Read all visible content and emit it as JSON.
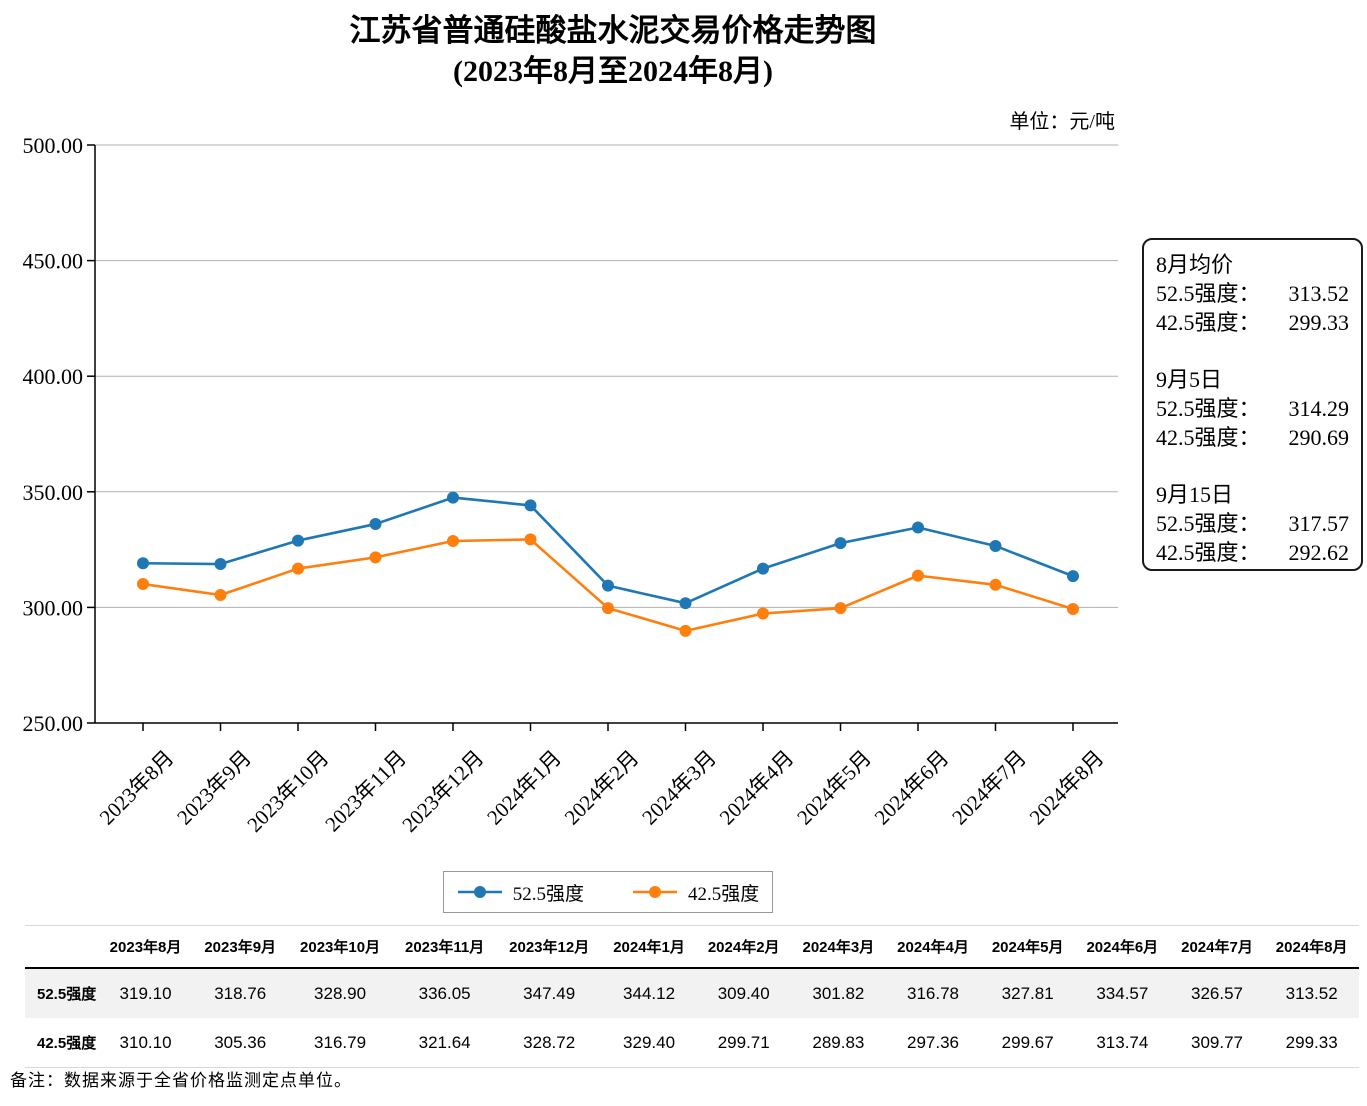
{
  "title": {
    "line1": "江苏省普通硅酸盐水泥交易价格走势图",
    "line2": "(2023年8月至2024年8月)"
  },
  "unit_label": "单位：元/吨",
  "colors": {
    "series_525": "#1f77b4",
    "series_425": "#ff7f0e",
    "gridline": "#b0b0b0",
    "axis": "#000000",
    "table_stripe": "#f2f2f2"
  },
  "chart_data": {
    "type": "line",
    "title": "江苏省普通硅酸盐水泥交易价格走势图 (2023年8月至2024年8月)",
    "xlabel": "",
    "ylabel": "元/吨",
    "ylim": [
      250,
      500
    ],
    "ytick_step": 50,
    "ytick_labels": [
      "250.00",
      "300.00",
      "350.00",
      "400.00",
      "450.00",
      "500.00"
    ],
    "grid": true,
    "legend_position": "bottom",
    "categories": [
      "2023年8月",
      "2023年9月",
      "2023年10月",
      "2023年11月",
      "2023年12月",
      "2024年1月",
      "2024年2月",
      "2024年3月",
      "2024年4月",
      "2024年5月",
      "2024年6月",
      "2024年7月",
      "2024年8月"
    ],
    "series": [
      {
        "name": "52.5强度",
        "color": "#1f77b4",
        "marker": "circle",
        "values": [
          319.1,
          318.76,
          328.9,
          336.05,
          347.49,
          344.12,
          309.4,
          301.82,
          316.78,
          327.81,
          334.57,
          326.57,
          313.52
        ]
      },
      {
        "name": "42.5强度",
        "color": "#ff7f0e",
        "marker": "circle",
        "values": [
          310.1,
          305.36,
          316.79,
          321.64,
          328.72,
          329.4,
          299.71,
          289.83,
          297.36,
          299.67,
          313.74,
          309.77,
          299.33
        ]
      }
    ]
  },
  "legend": {
    "items": [
      {
        "label": "52.5强度",
        "color": "#1f77b4"
      },
      {
        "label": "42.5强度",
        "color": "#ff7f0e"
      }
    ]
  },
  "annotation": {
    "groups": [
      {
        "header": "8月均价",
        "rows": [
          {
            "label": "52.5强度：",
            "value": "313.52"
          },
          {
            "label": "42.5强度：",
            "value": "299.33"
          }
        ]
      },
      {
        "header": "9月5日",
        "rows": [
          {
            "label": "52.5强度：",
            "value": "314.29"
          },
          {
            "label": "42.5强度：",
            "value": "290.69"
          }
        ]
      },
      {
        "header": "9月15日",
        "rows": [
          {
            "label": "52.5强度：",
            "value": "317.57"
          },
          {
            "label": "42.5强度：",
            "value": "292.62"
          }
        ]
      }
    ]
  },
  "table": {
    "corner_label": "",
    "columns": [
      "2023年8月",
      "2023年9月",
      "2023年10月",
      "2023年11月",
      "2023年12月",
      "2024年1月",
      "2024年2月",
      "2024年3月",
      "2024年4月",
      "2024年5月",
      "2024年6月",
      "2024年7月",
      "2024年8月"
    ],
    "rows": [
      {
        "label": "52.5强度",
        "values": [
          "319.10",
          "318.76",
          "328.90",
          "336.05",
          "347.49",
          "344.12",
          "309.40",
          "301.82",
          "316.78",
          "327.81",
          "334.57",
          "326.57",
          "313.52"
        ]
      },
      {
        "label": "42.5强度",
        "values": [
          "310.10",
          "305.36",
          "316.79",
          "321.64",
          "328.72",
          "329.40",
          "299.71",
          "289.83",
          "297.36",
          "299.67",
          "313.74",
          "309.77",
          "299.33"
        ]
      }
    ]
  },
  "footnote": "备注：数据来源于全省价格监测定点单位。"
}
